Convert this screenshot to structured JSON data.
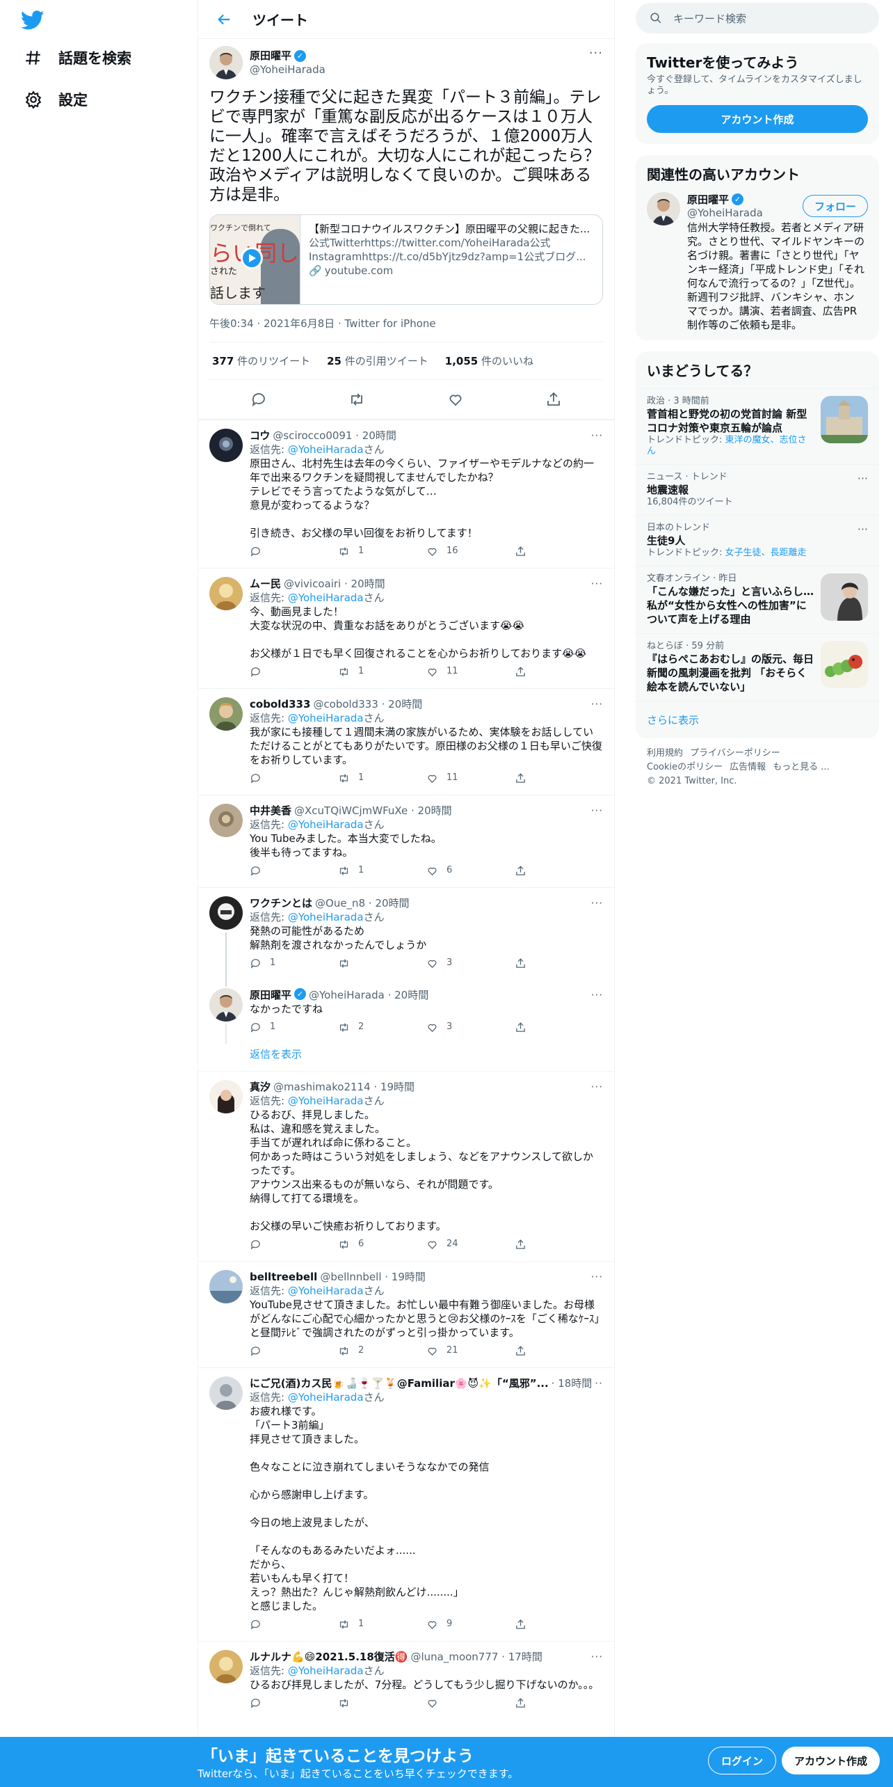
{
  "nav": {
    "logo": "twitter-bird-icon",
    "explore_label": "話題を検索",
    "settings_label": "設定"
  },
  "header": {
    "title": "ツイート"
  },
  "focal_tweet": {
    "author_name": "原田曜平",
    "author_handle": "@YoheiHarada",
    "text": "ワクチン接種で父に起きた異変「パート３前編」。テレビで専門家が「重篤な副反応が出るケースは１０万人に一人」。確率で言えばそうだろうが、１億2000万人だと1200人にこれが。大切な人にこれが起こったら？政治やメディアは説明しなくて良いのか。ご興味ある方は是非。",
    "card": {
      "thumb_line1": "ワクチンで倒れて",
      "thumb_line2": "らい同し",
      "thumb_line3": "された",
      "thumb_line4": "話します",
      "title": "【新型コロナウイルスワクチン】原田曜平の父親に起きた...",
      "description": "公式Twitterhttps://twitter.com/YoheiHarada公式Instagramhttps://t.co/d5bYjtz9dz?amp=1公式ブログ...",
      "domain": "youtube.com"
    },
    "timestamp": "午後0:34 · 2021年6月8日 · Twitter for iPhone",
    "stats": [
      {
        "count": "377",
        "label": "件のリツイート"
      },
      {
        "count": "25",
        "label": "件の引用ツイート"
      },
      {
        "count": "1,055",
        "label": "件のいいね"
      }
    ]
  },
  "replies": [
    {
      "name": "コウ",
      "meta": "@scirocco0091 · 20時間",
      "to_prefix": "返信先: ",
      "to": "@YoheiHarada",
      "to_suffix": "さん",
      "text": "原田さん、北村先生は去年の今くらい、ファイザーやモデルナなどの約一年で出来るワクチンを疑問視してませんでしたかね？\nテレビでそう言ってたような気がして…\n意見が変わってるような？\n\n引き続き、お父様の早い回復をお祈りしてます！",
      "replies": "",
      "retweets": "1",
      "likes": "16",
      "avatar": "dark"
    },
    {
      "name": "ムー民",
      "meta": "@vivicoairi · 20時間",
      "to_prefix": "返信先: ",
      "to": "@YoheiHarada",
      "to_suffix": "さん",
      "text": "今、動画見ました！\n大変な状況の中、貴重なお話をありがとうございます😭😭\n\nお父様が１日でも早く回復されることを心からお祈りしております😭😭",
      "replies": "",
      "retweets": "1",
      "likes": "11",
      "avatar": "gold"
    },
    {
      "name": "cobold333",
      "meta": "@cobold333 · 20時間",
      "to_prefix": "返信先: ",
      "to": "@YoheiHarada",
      "to_suffix": "さん",
      "text": "我が家にも接種して１週間未満の家族がいるため、実体験をお話ししていただけることがとてもありがたいです。原田様のお父様の１日も早いご快復をお祈りしています。",
      "replies": "",
      "retweets": "1",
      "likes": "11",
      "avatar": "portrait"
    },
    {
      "name": "中井美香",
      "meta": "@XcuTQiWCjmWFuXe · 20時間",
      "to_prefix": "返信先: ",
      "to": "@YoheiHarada",
      "to_suffix": "さん",
      "text": "You Tubeみました。本当大変でしたね。\n後半も待ってますね。",
      "replies": "",
      "retweets": "1",
      "likes": "6",
      "avatar": "statue"
    },
    {
      "name": "ワクチンとは",
      "meta": "@Oue_n8 · 20時間",
      "to_prefix": "返信先: ",
      "to": "@YoheiHarada",
      "to_suffix": "さん",
      "text": "発熱の可能性があるため\n解熱剤を渡されなかったんでしょうか",
      "replies": "1",
      "retweets": "",
      "likes": "3",
      "avatar": "black"
    },
    {
      "name": "原田曜平",
      "meta": "@YoheiHarada · 20時間",
      "to_prefix": "",
      "to": "",
      "to_suffix": "",
      "text": "なかったですね",
      "replies": "1",
      "retweets": "2",
      "likes": "3",
      "avatar": "harada",
      "verified": true
    },
    {
      "name": "真汐",
      "meta": "@mashimako2114 · 19時間",
      "to_prefix": "返信先: ",
      "to": "@YoheiHarada",
      "to_suffix": "さん",
      "text": "ひるおび、拝見しました。\n私は、違和感を覚えました。\n手当てが遅れれば命に係わること。\n何かあった時はこういう対処をしましょう、などをアナウンスして欲しかったです。\nアナウンス出来るものが無いなら、それが問題です。\n納得して打てる環境を。\n\nお父様の早いご快癒お祈りしております。",
      "replies": "",
      "retweets": "6",
      "likes": "24",
      "avatar": "woman"
    },
    {
      "name": "belltreebell",
      "meta": "@bellnnbell · 19時間",
      "to_prefix": "返信先: ",
      "to": "@YoheiHarada",
      "to_suffix": "さん",
      "text": "YouTube見させて頂きました。お忙しい最中有難う御座いました。お母様がどんなにご心配で心細かったかと思うと😢お父様のｹｰｽを「ごく稀なｹｰｽ」と昼間ﾃﾚﾋﾞで強調されたのがずっと引っ掛かっています。",
      "replies": "",
      "retweets": "2",
      "likes": "21",
      "avatar": "sky"
    },
    {
      "name": "にご兄(酒)カス民🍺🍶🍷🍸🍹@Familiar🌸😈✨「“風邪”...",
      "meta": "· 18時間",
      "to_prefix": "返信先: ",
      "to": "@YoheiHarada",
      "to_suffix": "さん",
      "text": "お疲れ様です。\n「パート3前編」\n拝見させて頂きました。\n\n色々なことに泣き崩れてしまいそうななかでの発信\n\n心から感謝申し上げます。\n\n今日の地上波見ましたが、\n\n「そんなのもあるみたいだよォ......\nだから、\n若いもんも早く打て！\nえっ？熱出た？んじゃ解熱剤飲んどけ........」\nと感じました。",
      "replies": "",
      "retweets": "1",
      "likes": "9",
      "avatar": "grey"
    },
    {
      "name": "ルナルナ💪😄2021.5.18復活🉐",
      "meta": "@luna_moon777 · 17時間",
      "to_prefix": "返信先: ",
      "to": "@YoheiHarada",
      "to_suffix": "さん",
      "text": "ひるおび拝見しましたが、7分程。どうしてもう少し掘り下げないのか。。。",
      "replies": "",
      "retweets": "",
      "likes": "",
      "avatar": "gold"
    }
  ],
  "show_replies_label": "返信を表示",
  "sidebar": {
    "search_placeholder": "キーワード検索",
    "signup": {
      "title": "Twitterを使ってみよう",
      "subtitle": "今すぐ登録して、タイムラインをカスタマイズしましょう。",
      "button": "アカウント作成"
    },
    "related": {
      "title": "関連性の高いアカウント",
      "name": "原田曜平",
      "handle": "@YoheiHarada",
      "follow": "フォロー",
      "bio": "信州大学特任教授。若者とメディア研究。さとり世代、マイルドヤンキーの名づけ親。著書に「さとり世代」「ヤンキー経済」「平成トレンド史」「それ何なんで流行ってるの？」「Z世代」。新週刊フジ批評、バンキシャ、ホンマでっか。講演、若者調査、広告PR制作等のご依頼も是非。"
    },
    "trends": {
      "title": "いまどうしてる？",
      "items": [
        {
          "meta": "政治 · 3 時間前",
          "title": "菅首相と野党の初の党首討論 新型コロナ対策や東京五輪が論点",
          "sub_prefix": "トレンドトピック: ",
          "sub_link": "東洋の魔女、志位さん",
          "image": "building"
        },
        {
          "meta": "ニュース · トレンド",
          "title": "地震速報",
          "sub_prefix": "16,804件のツイート",
          "sub_link": "",
          "image": ""
        },
        {
          "meta": "日本のトレンド",
          "title": "生徒9人",
          "sub_prefix": "トレンドトピック: ",
          "sub_link": "女子生徒、長距離走",
          "image": ""
        },
        {
          "meta": "文春オンライン · 昨日",
          "title": "「こんな嫌だった」と言いふらし…私が“女性から女性への性加害”について声を上げる理由",
          "sub_prefix": "",
          "sub_link": "",
          "image": "woman"
        },
        {
          "meta": "ねとらぼ · 59 分前",
          "title": "『はらぺこあおむし』の版元、毎日新聞の風刺漫画を批判 「おそらく絵本を読んでいない」",
          "sub_prefix": "",
          "sub_link": "",
          "image": "caterpillar"
        }
      ],
      "show_more": "さらに表示"
    },
    "footer": {
      "line1": [
        "利用規約",
        "プライバシーポリシー"
      ],
      "line2": [
        "Cookieのポリシー",
        "広告情報",
        "もっと見る ..."
      ],
      "copyright": "© 2021 Twitter, Inc."
    }
  },
  "bottom_bar": {
    "title": "「いま」起きていることを見つけよう",
    "subtitle": "Twitterなら、「いま」起きていることをいち早くチェックできます。",
    "login": "ログイン",
    "signup": "アカウント作成"
  },
  "colors": {
    "accent": "#1d9bf0",
    "text": "#0f1419",
    "muted": "#536471",
    "border": "#eff3f4"
  }
}
